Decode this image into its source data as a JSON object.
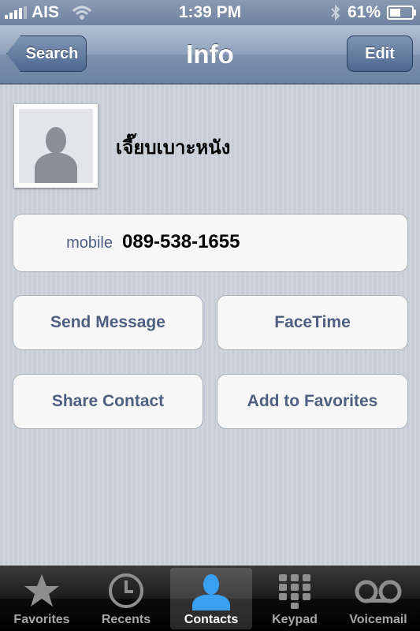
{
  "status_bar": {
    "carrier": "AIS",
    "time": "1:39 PM",
    "battery_percent": "61%",
    "battery_level": 0.61,
    "icons": [
      "signal-bars-icon",
      "wifi-icon",
      "bluetooth-icon",
      "battery-icon"
    ]
  },
  "nav": {
    "back_label": "Search",
    "title": "Info",
    "edit_label": "Edit"
  },
  "contact": {
    "name": "เจี๊ยบเบาะหนัง",
    "phone_label": "mobile",
    "phone_number": "089-538-1655",
    "photo_icon": "person-silhouette-icon"
  },
  "actions": {
    "send_message": "Send Message",
    "facetime": "FaceTime",
    "share_contact": "Share Contact",
    "add_to_favorites": "Add to Favorites"
  },
  "tabs": [
    {
      "label": "Favorites",
      "icon": "star-icon",
      "active": false
    },
    {
      "label": "Recents",
      "icon": "clock-icon",
      "active": false
    },
    {
      "label": "Contacts",
      "icon": "person-icon",
      "active": true
    },
    {
      "label": "Keypad",
      "icon": "keypad-icon",
      "active": false
    },
    {
      "label": "Voicemail",
      "icon": "voicemail-icon",
      "active": false
    }
  ],
  "colors": {
    "nav_blue": "#6d83a4",
    "button_text": "#4e5f81",
    "contacts_tab_blue": "#3aa0f0"
  }
}
